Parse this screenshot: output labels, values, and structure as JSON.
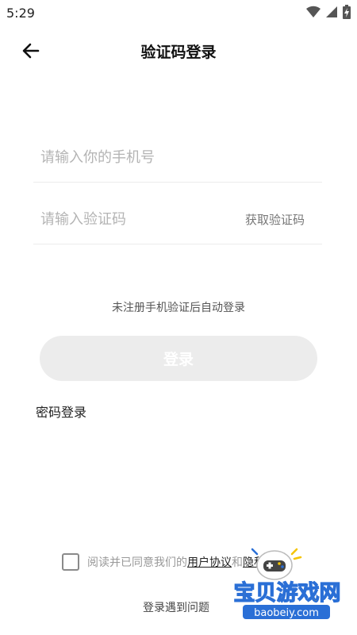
{
  "status_bar": {
    "time": "5:29",
    "icons": [
      "wifi-icon",
      "signal-icon",
      "battery-charging-icon"
    ]
  },
  "header": {
    "back_icon": "arrow-left-icon",
    "title": "验证码登录"
  },
  "form": {
    "phone_placeholder": "请输入你的手机号",
    "phone_value": "",
    "code_placeholder": "请输入验证码",
    "code_value": "",
    "get_code_label": "获取验证码",
    "hint": "未注册手机验证后自动登录",
    "login_label": "登录",
    "password_login_label": "密码登录"
  },
  "agreement": {
    "checked": false,
    "prefix": "阅读并已同意我们的",
    "user_agreement": "用户协议",
    "and": "和",
    "privacy_policy": "隐私条款"
  },
  "footer": {
    "problem_label": "登录遇到问题"
  },
  "watermark": {
    "title": "宝贝游戏网",
    "url": "baobeiy.com"
  },
  "colors": {
    "login_button_bg": "#ececec",
    "watermark_blue": "#2a6fd6",
    "watermark_yellow": "#f5c400"
  }
}
